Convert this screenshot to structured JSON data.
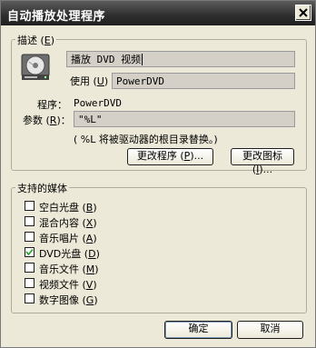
{
  "window": {
    "title": "自动播放处理程序"
  },
  "description_group": {
    "legend": "描述",
    "legend_key": "E",
    "description_value": "播放 DVD 视频",
    "use_label": "使用",
    "use_key": "U",
    "use_value": "PowerDVD",
    "program_label": "程序：",
    "program_value": "PowerDVD",
    "params_label": "参数",
    "params_key": "R",
    "params_suffix": "：",
    "params_value": "\"%L\"",
    "hint": "( %L 将被驱动器的根目录替换。)",
    "change_program_button": "更改程序",
    "change_program_key": "P",
    "change_icon_button": "更改图标",
    "change_icon_key": "I",
    "ellipsis": "..."
  },
  "media_group": {
    "legend": "支持的媒体",
    "items": [
      {
        "label": "空白光盘",
        "key": "B",
        "checked": false
      },
      {
        "label": "混合内容",
        "key": "X",
        "checked": false
      },
      {
        "label": "音乐唱片",
        "key": "A",
        "checked": false
      },
      {
        "label": "DVD光盘",
        "key": "D",
        "checked": true
      },
      {
        "label": "音乐文件",
        "key": "M",
        "checked": false
      },
      {
        "label": "视频文件",
        "key": "V",
        "checked": false
      },
      {
        "label": "数字图像",
        "key": "G",
        "checked": false
      }
    ]
  },
  "footer": {
    "ok": "确定",
    "cancel": "取消"
  },
  "icons": {
    "close": "close-icon",
    "drive": "dvd-drive-icon",
    "check": "check-icon"
  }
}
